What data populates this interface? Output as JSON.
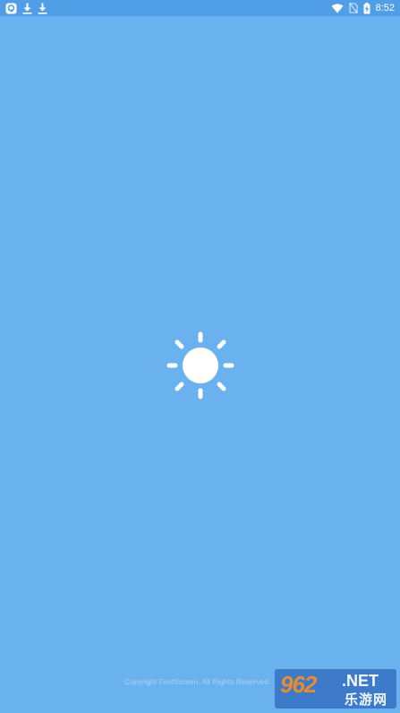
{
  "status_bar": {
    "left_icons": [
      "app-notification-icon",
      "download-icon",
      "download-icon"
    ],
    "right_icons": [
      "wifi-icon",
      "no-sim-icon",
      "battery-charging-icon"
    ],
    "time": "8:52"
  },
  "splash": {
    "logo_icon": "sun-icon",
    "copyright": "Copyright FirstScreen. All Rights Reserved."
  },
  "watermark": {
    "number": "962",
    "domain": ".NET",
    "chinese": "乐游网"
  },
  "colors": {
    "background": "#6ab2ee",
    "status_bar": "#4f9ee6",
    "icon": "#ffffff",
    "watermark_bg": "#3a76c8",
    "watermark_accent": "#f28a1e"
  }
}
